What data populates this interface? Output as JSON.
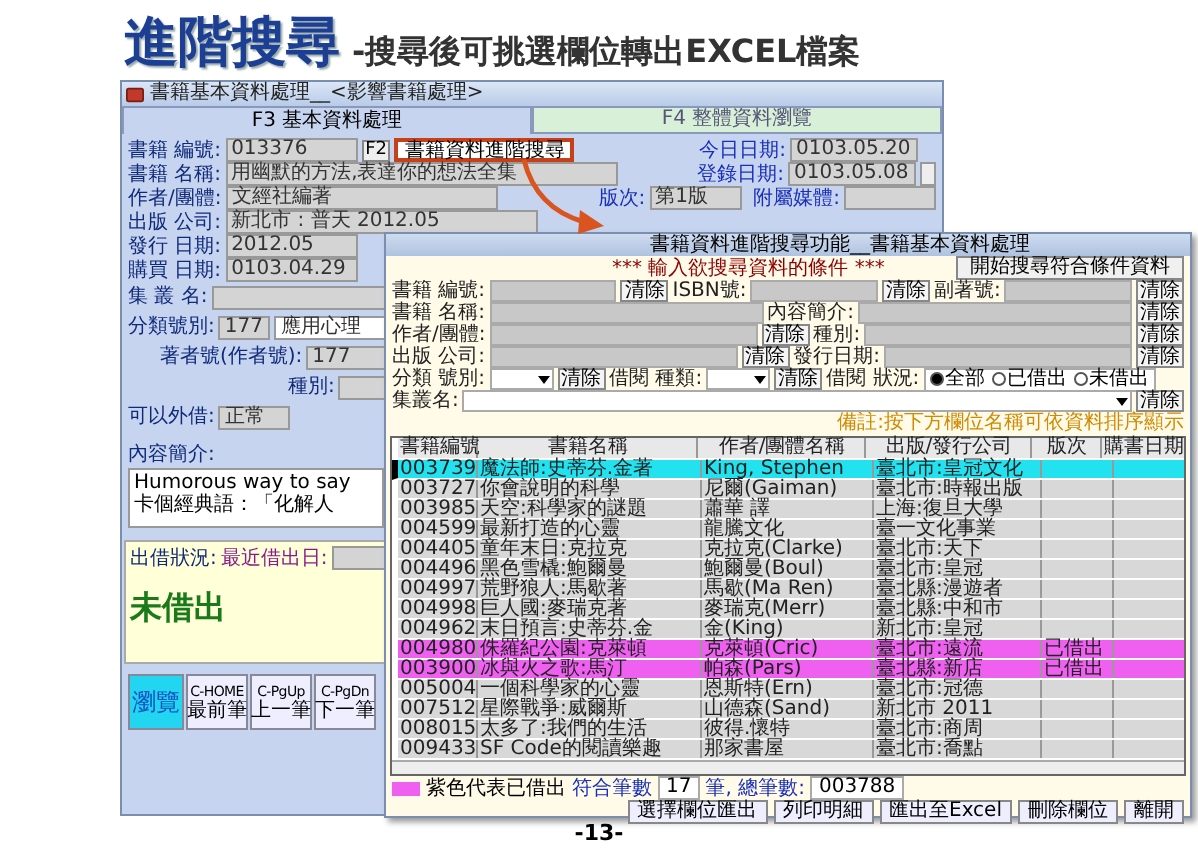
{
  "slide": {
    "title": "進階搜尋",
    "subtitle": "-搜尋後可挑選欄位轉出EXCEL檔案",
    "page_number": "-13-"
  },
  "main_window": {
    "title": "書籍基本資料處理__<影響書籍處理>",
    "tabs": [
      {
        "label": "F3 基本資料處理",
        "selected": true
      },
      {
        "label": "F4 整體資料瀏覽",
        "selected": false
      }
    ],
    "book_id": {
      "label": "書籍 編號:",
      "value": "013376",
      "key": "F2"
    },
    "advanced_search_button": "書籍資料進階搜尋",
    "today": {
      "label": "今日日期:",
      "value": "0103.05.20"
    },
    "registered": {
      "label": "登錄日期:",
      "value": "0103.05.08"
    },
    "book_name": {
      "label": "書籍 名稱:",
      "value": "用幽默的方法,表達你的想法全集"
    },
    "author": {
      "label": "作者/團體:",
      "value": "文經社編著"
    },
    "edition": {
      "label": "版次:",
      "value": "第1版"
    },
    "media": {
      "label": "附屬媒體:"
    },
    "publisher": {
      "label": "出版 公司:",
      "value": "新北市 : 普天 2012.05"
    },
    "issue_date": {
      "label": "發行 日期:",
      "value": "2012.05"
    },
    "purchase_date": {
      "label": "購買 日期:",
      "value": "0103.04.29"
    },
    "series": {
      "label": "集 叢 名:"
    },
    "class": {
      "label": "分類號別:",
      "value": "177",
      "name": "應用心理"
    },
    "author_no": {
      "label": "著者號(作者號):",
      "value": "177"
    },
    "type": {
      "label": "種別:"
    },
    "lendable": {
      "label": "可以外借:",
      "value": "正常"
    },
    "summary": {
      "label": "內容簡介:",
      "lines": [
        "Humorous way to say",
        "卡個經典語：「化解人"
      ]
    },
    "loan": {
      "label": "出借狀況:",
      "last_label": "最近借出日:",
      "status": "未借出"
    },
    "nav_buttons": [
      {
        "kind": "big",
        "label": "瀏覽"
      },
      {
        "kind": "nav",
        "key": "C-HOME",
        "label": "最前筆"
      },
      {
        "kind": "nav",
        "key": "C-PgUp",
        "label": "上一筆"
      },
      {
        "kind": "nav",
        "key": "C-PgDn",
        "label": "下一筆"
      }
    ]
  },
  "search_dialog": {
    "title": "書籍資料進階搜尋功能__書籍基本資料處理",
    "prompt": "*** 輸入欲搜尋資料的條件 ***",
    "search_button": "開始搜尋符合條件資料",
    "filter_rows": [
      [
        {
          "kind": "field",
          "label": "書籍 編號:",
          "clear": "清除"
        },
        {
          "kind": "field",
          "label": "ISBN號:",
          "clear": "清除"
        },
        {
          "kind": "field",
          "label": "副著號:",
          "clear": "清除"
        }
      ],
      [
        {
          "kind": "field",
          "label": "書籍 名稱:"
        },
        {
          "kind": "field",
          "label": "內容簡介:",
          "clear": "清除"
        }
      ],
      [
        {
          "kind": "field",
          "label": "作者/團體:",
          "clear": "清除"
        },
        {
          "kind": "field",
          "label": "種別:",
          "clear": "清除"
        }
      ],
      [
        {
          "kind": "field",
          "label": "出版 公司:",
          "clear": "清除"
        },
        {
          "kind": "field",
          "label": "發行日期:",
          "clear": "清除"
        }
      ],
      [
        {
          "kind": "dropdown",
          "label": "分類 號別:",
          "clear": "清除"
        },
        {
          "kind": "dropdown",
          "label": "借閱 種類:",
          "clear": "清除"
        },
        {
          "kind": "radio",
          "label": "借閱 狀況:",
          "options": [
            {
              "label": "全部",
              "selected": true
            },
            {
              "label": "已借出",
              "selected": false
            },
            {
              "label": "未借出",
              "selected": false
            }
          ]
        }
      ],
      [
        {
          "kind": "dropdown",
          "label": "集叢名:",
          "clear": "清除"
        }
      ]
    ],
    "note": "備註:按下方欄位名稱可依資料排序顯示",
    "columns": [
      "書籍編號",
      "書籍名稱",
      "作者/團體名稱",
      "出版/發行公司",
      "版次",
      "購書日期"
    ],
    "rows": [
      {
        "id": "003739",
        "title": "魔法師:史蒂芬.金著",
        "author": "King, Stephen",
        "publisher": "臺北市:皇冠文化",
        "selected": true,
        "borrowed": false
      },
      {
        "id": "003727",
        "title": "你會說明的科學",
        "author": "尼爾(Gaiman)",
        "publisher": "臺北市:時報出版",
        "selected": false,
        "borrowed": false
      },
      {
        "id": "003985",
        "title": "天空:科學家的謎題",
        "author": "蕭華 譯",
        "publisher": "上海:復旦大學",
        "selected": false,
        "borrowed": false
      },
      {
        "id": "004599",
        "title": "最新打造的心靈",
        "author": "龍騰文化",
        "publisher": "臺一文化事業",
        "selected": false,
        "borrowed": false
      },
      {
        "id": "004405",
        "title": "童年末日:克拉克",
        "author": "克拉克(Clarke)",
        "publisher": "臺北市:天下",
        "selected": false,
        "borrowed": false
      },
      {
        "id": "004496",
        "title": "黑色雪橇:鮑爾曼",
        "author": "鮑爾曼(Boul)",
        "publisher": "臺北市:皇冠",
        "selected": false,
        "borrowed": false
      },
      {
        "id": "004997",
        "title": "荒野狼人:馬歇著",
        "author": "馬歇(Ma Ren)",
        "publisher": "臺北縣:漫遊者",
        "selected": false,
        "borrowed": false
      },
      {
        "id": "004998",
        "title": "巨人國:麥瑞克著",
        "author": "麥瑞克(Merr)",
        "publisher": "臺北縣:中和市",
        "selected": false,
        "borrowed": false
      },
      {
        "id": "004962",
        "title": "末日預言:史蒂芬.金",
        "author": "金(King)",
        "publisher": "新北市:皇冠",
        "selected": false,
        "borrowed": false
      },
      {
        "id": "004980",
        "title": "侏羅紀公園:克萊頓",
        "author": "克萊頓(Cric)",
        "publisher": "臺北市:遠流",
        "status": "已借出",
        "selected": false,
        "borrowed": true
      },
      {
        "id": "003900",
        "title": "冰與火之歌:馬汀",
        "author": "帕森(Pars)",
        "publisher": "臺北縣:新店",
        "status": "已借出",
        "selected": false,
        "borrowed": true
      },
      {
        "id": "005004",
        "title": "一個科學家的心靈",
        "author": "恩斯特(Ern)",
        "publisher": "臺北市:冠德",
        "selected": false,
        "borrowed": false
      },
      {
        "id": "007512",
        "title": "星際戰爭:威爾斯",
        "author": "山德森(Sand)",
        "publisher": "新北市 2011",
        "selected": false,
        "borrowed": false
      },
      {
        "id": "008015",
        "title": "太多了:我們的生活",
        "author": "彼得.懷特",
        "publisher": "臺北市:商周",
        "selected": false,
        "borrowed": false
      },
      {
        "id": "009433",
        "title": "SF Code的閱讀樂趣",
        "author": "那家書屋",
        "publisher": "臺北市:喬點",
        "selected": false,
        "borrowed": false
      }
    ],
    "legend": "紫色代表已借出",
    "count_label": "符合筆數",
    "count": "17",
    "total_label": "筆, 總筆數:",
    "total": "003788",
    "buttons": [
      "選擇欄位匯出",
      "列印明細",
      "匯出至Excel",
      "刪除欄位",
      "離開"
    ]
  }
}
